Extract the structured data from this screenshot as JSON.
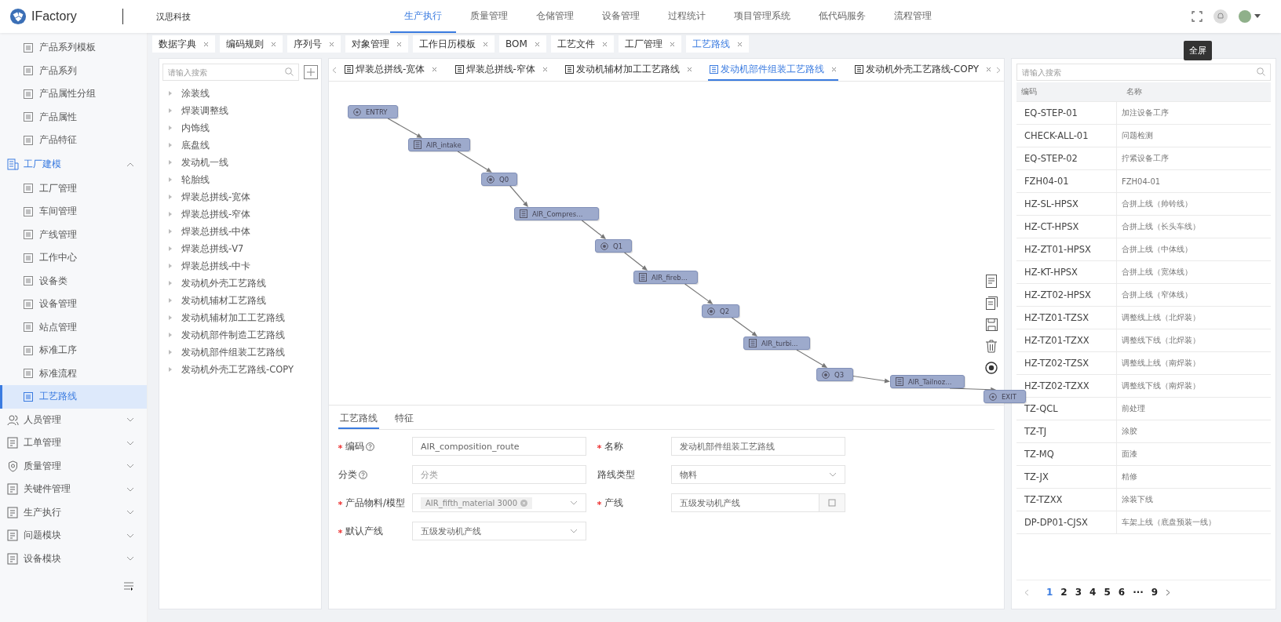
{
  "header": {
    "app_name": "IFactory",
    "company": "汉思科技",
    "nav": [
      {
        "label": "生产执行",
        "selected": true
      },
      {
        "label": "质量管理",
        "selected": false
      },
      {
        "label": "仓储管理",
        "selected": false
      },
      {
        "label": "设备管理",
        "selected": false
      },
      {
        "label": "过程统计",
        "selected": false
      },
      {
        "label": "项目管理系统",
        "selected": false
      },
      {
        "label": "低代码服务",
        "selected": false
      },
      {
        "label": "流程管理",
        "selected": false
      }
    ],
    "tooltip": "全屏"
  },
  "sidebar": {
    "items": [
      {
        "kind": "leaf",
        "label": "产品系列模板",
        "selected": false
      },
      {
        "kind": "leaf",
        "label": "产品系列",
        "selected": false
      },
      {
        "kind": "leaf",
        "label": "产品属性分组",
        "selected": false
      },
      {
        "kind": "leaf",
        "label": "产品属性",
        "selected": false
      },
      {
        "kind": "leaf",
        "label": "产品特征",
        "selected": false
      },
      {
        "kind": "group",
        "label": "工厂建模",
        "expanded": true,
        "children": [
          {
            "label": "工厂管理",
            "selected": false
          },
          {
            "label": "车间管理",
            "selected": false
          },
          {
            "label": "产线管理",
            "selected": false
          },
          {
            "label": "工作中心",
            "selected": false
          },
          {
            "label": "设备类",
            "selected": false
          },
          {
            "label": "设备管理",
            "selected": false
          },
          {
            "label": "站点管理",
            "selected": false
          },
          {
            "label": "标准工序",
            "selected": false
          },
          {
            "label": "标准流程",
            "selected": false
          },
          {
            "label": "工艺路线",
            "selected": true
          }
        ]
      },
      {
        "kind": "group",
        "label": "人员管理",
        "expanded": false
      },
      {
        "kind": "group",
        "label": "工单管理",
        "expanded": false
      },
      {
        "kind": "group",
        "label": "质量管理",
        "expanded": false
      },
      {
        "kind": "group",
        "label": "关键件管理",
        "expanded": false
      },
      {
        "kind": "group",
        "label": "生产执行",
        "expanded": false
      },
      {
        "kind": "group",
        "label": "问题模块",
        "expanded": false
      },
      {
        "kind": "group",
        "label": "设备模块",
        "expanded": false
      }
    ]
  },
  "page_tabs": [
    {
      "label": "数据字典",
      "selected": false
    },
    {
      "label": "编码规则",
      "selected": false
    },
    {
      "label": "序列号",
      "selected": false
    },
    {
      "label": "对象管理",
      "selected": false
    },
    {
      "label": "工作日历模板",
      "selected": false
    },
    {
      "label": "BOM",
      "selected": false
    },
    {
      "label": "工艺文件",
      "selected": false
    },
    {
      "label": "工厂管理",
      "selected": false
    },
    {
      "label": "工艺路线",
      "selected": true
    }
  ],
  "tree": {
    "search": {
      "placeholder": "请输入搜索"
    },
    "items": [
      "涂装线",
      "焊装调整线",
      "内饰线",
      "底盘线",
      "发动机一线",
      "轮胎线",
      "焊装总拼线-宽体",
      "焊装总拼线-窄体",
      "焊装总拼线-中体",
      "焊装总拼线-V7",
      "焊装总拼线-中卡",
      "发动机外壳工艺路线",
      "发动机辅材工艺路线",
      "发动机辅材加工工艺路线",
      "发动机部件制造工艺路线",
      "发动机部件组装工艺路线",
      "发动机外壳工艺路线-COPY"
    ]
  },
  "route_tabs": [
    {
      "label": "焊装总拼线-宽体",
      "selected": false
    },
    {
      "label": "焊装总拼线-窄体",
      "selected": false
    },
    {
      "label": "发动机辅材加工工艺路线",
      "selected": false
    },
    {
      "label": "发动机部件组装工艺路线",
      "selected": true
    },
    {
      "label": "发动机外壳工艺路线-COPY",
      "selected": false
    }
  ],
  "graph": {
    "nodes": [
      {
        "kind": "terminal",
        "label": "ENTRY"
      },
      {
        "kind": "operation",
        "label": "AIR_intake"
      },
      {
        "kind": "queue",
        "label": "Q0"
      },
      {
        "kind": "operation",
        "label": "AIR_Compres..."
      },
      {
        "kind": "queue",
        "label": "Q1"
      },
      {
        "kind": "operation",
        "label": "AIR_fireb..."
      },
      {
        "kind": "queue",
        "label": "Q2"
      },
      {
        "kind": "operation",
        "label": "AIR_turbi..."
      },
      {
        "kind": "queue",
        "label": "Q3"
      },
      {
        "kind": "operation",
        "label": "AIR_Tailnoz..."
      },
      {
        "kind": "terminal",
        "label": "EXIT"
      }
    ]
  },
  "form": {
    "tabs": [
      {
        "label": "工艺路线",
        "selected": true
      },
      {
        "label": "特征",
        "selected": false
      }
    ],
    "fields": [
      {
        "label": "编码",
        "required": true,
        "help": true,
        "kind": "text",
        "value": "AIR_composition_route"
      },
      {
        "label": "名称",
        "required": true,
        "help": false,
        "kind": "text",
        "value": "发动机部件组装工艺路线"
      },
      {
        "label": "分类",
        "required": false,
        "help": true,
        "kind": "text",
        "placeholder": "分类"
      },
      {
        "label": "路线类型",
        "required": false,
        "help": false,
        "kind": "select",
        "value": "物料"
      },
      {
        "label": "产品物料/模型",
        "required": true,
        "help": false,
        "kind": "tag-select",
        "value": "AIR_fifth_material 3000"
      },
      {
        "label": "产线",
        "required": true,
        "help": false,
        "kind": "lookup",
        "value": "五级发动机产线"
      },
      {
        "label": "默认产线",
        "required": true,
        "help": false,
        "kind": "select",
        "value": "五级发动机产线"
      }
    ]
  },
  "steps_table": {
    "search": {
      "placeholder": "请输入搜索"
    },
    "columns": [
      "编码",
      "名称"
    ],
    "rows": [
      [
        "EQ-STEP-01",
        "加注设备工序"
      ],
      [
        "CHECK-ALL-01",
        "问题检测"
      ],
      [
        "EQ-STEP-02",
        "拧紧设备工序"
      ],
      [
        "FZH04-01",
        "FZH04-01"
      ],
      [
        "HZ-SL-HPSX",
        "合拼上线（帅铃线）"
      ],
      [
        "HZ-CT-HPSX",
        "合拼上线（长头车线）"
      ],
      [
        "HZ-ZT01-HPSX",
        "合拼上线（中体线）"
      ],
      [
        "HZ-KT-HPSX",
        "合拼上线（宽体线）"
      ],
      [
        "HZ-ZT02-HPSX",
        "合拼上线（窄体线）"
      ],
      [
        "HZ-TZ01-TZSX",
        "调整线上线（北焊装）"
      ],
      [
        "HZ-TZ01-TZXX",
        "调整线下线（北焊装）"
      ],
      [
        "HZ-TZ02-TZSX",
        "调整线上线（南焊装）"
      ],
      [
        "HZ-TZ02-TZXX",
        "调整线下线（南焊装）"
      ],
      [
        "TZ-QCL",
        "前处理"
      ],
      [
        "TZ-TJ",
        "涂胶"
      ],
      [
        "TZ-MQ",
        "面漆"
      ],
      [
        "TZ-JX",
        "精修"
      ],
      [
        "TZ-TZXX",
        "涂装下线"
      ],
      [
        "DP-DP01-CJSX",
        "车架上线（底盘预装一线）"
      ]
    ],
    "pagination": [
      {
        "label": "1",
        "selected": true
      },
      {
        "label": "2",
        "selected": false
      },
      {
        "label": "3",
        "selected": false
      },
      {
        "label": "4",
        "selected": false
      },
      {
        "label": "5",
        "selected": false
      },
      {
        "label": "6",
        "selected": false
      },
      {
        "label": "···",
        "selected": false
      },
      {
        "label": "9",
        "selected": false
      }
    ]
  }
}
